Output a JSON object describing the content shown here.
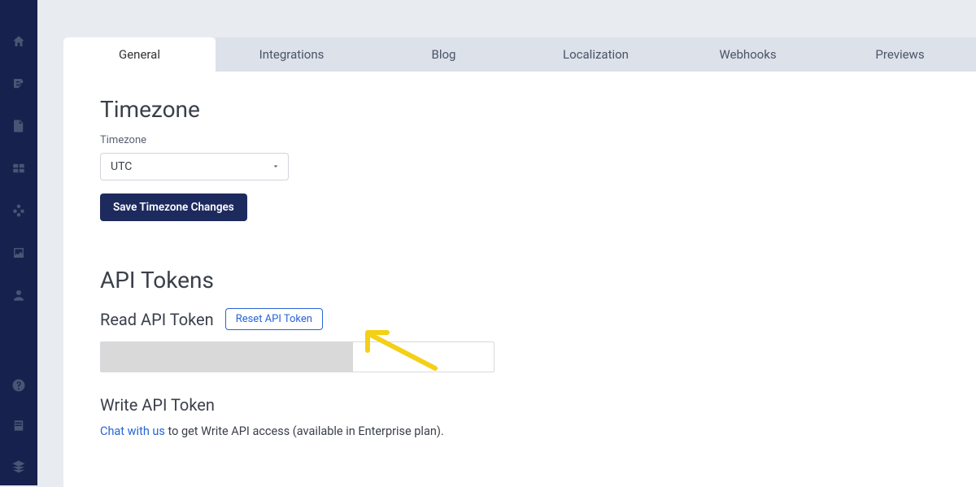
{
  "sidebar": {
    "top_icons": [
      "home-icon",
      "blog-icon",
      "page-icon",
      "grid-icon",
      "components-icon",
      "image-icon",
      "users-icon"
    ],
    "bottom_icons": [
      "help-icon",
      "book-icon",
      "layers-icon"
    ]
  },
  "tabs": [
    {
      "label": "General",
      "active": true
    },
    {
      "label": "Integrations",
      "active": false
    },
    {
      "label": "Blog",
      "active": false
    },
    {
      "label": "Localization",
      "active": false
    },
    {
      "label": "Webhooks",
      "active": false
    },
    {
      "label": "Previews",
      "active": false
    }
  ],
  "timezone": {
    "title": "Timezone",
    "label": "Timezone",
    "value": "UTC",
    "save_button": "Save Timezone Changes"
  },
  "api": {
    "title": "API Tokens",
    "read": {
      "title": "Read API Token",
      "reset_button": "Reset API Token"
    },
    "write": {
      "title": "Write API Token",
      "link_text": "Chat with us",
      "suffix_text": " to get Write API access (available in Enterprise plan)."
    }
  }
}
